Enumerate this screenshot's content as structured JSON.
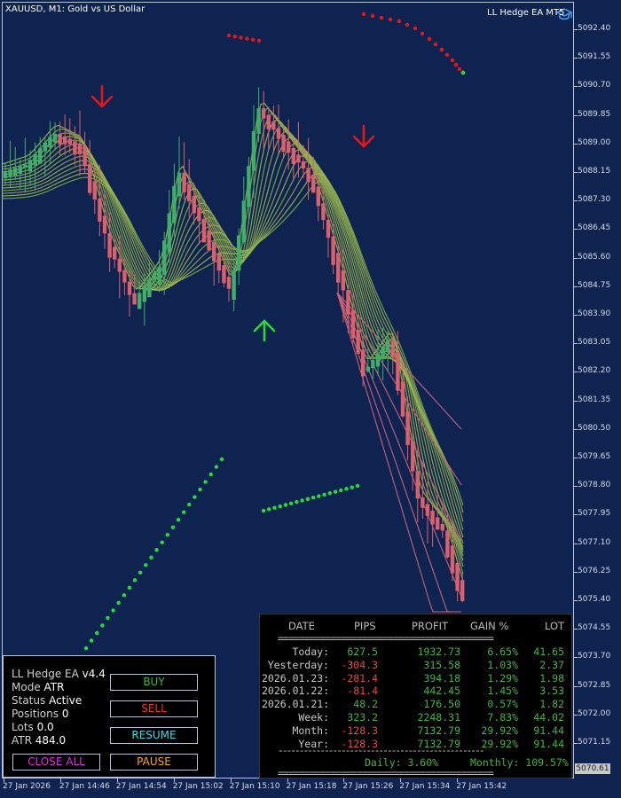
{
  "chart": {
    "title": "XAUUSD, M1:  Gold vs US Dollar",
    "ea_label": "LL Hedge EA MT5",
    "y_axis_labels": [
      "5092.40",
      "5091.55",
      "5090.70",
      "5089.85",
      "5089.00",
      "5088.15",
      "5087.30",
      "5086.45",
      "5085.60",
      "5084.75",
      "5083.90",
      "5083.05",
      "5082.20",
      "5081.35",
      "5080.50",
      "5079.65",
      "5078.80",
      "5077.95",
      "5077.10",
      "5076.25",
      "5075.40",
      "5074.55",
      "5073.70",
      "5072.85",
      "5072.00",
      "5071.15"
    ],
    "x_axis_labels": [
      "27 Jan 2026",
      "27 Jan 14:46",
      "27 Jan 14:54",
      "27 Jan 15:02",
      "27 Jan 15:10",
      "27 Jan 15:18",
      "27 Jan 15:26",
      "27 Jan 15:34",
      "27 Jan 15:42"
    ],
    "current_price": "5070.61",
    "colors": {
      "background": "#0f2350",
      "bull": "#3fae6a",
      "bear": "#d9606c",
      "ribbon": "#8fbf4a",
      "signal_up": "#22dd33",
      "signal_down": "#e21818"
    },
    "icons": [
      "arrow-down-icon",
      "arrow-down-icon",
      "arrow-up-icon",
      "graduation-cap-icon"
    ]
  },
  "ea_panel": {
    "name": "LL Hedge EA",
    "version": "v4.4",
    "mode_label": "Mode",
    "mode_value": "ATR",
    "status_label": "Status",
    "status_value": "Active",
    "positions_label": "Positions",
    "positions_value": "0",
    "lots_label": "Lots",
    "lots_value": "0.0",
    "atr_label": "ATR",
    "atr_value": "484.0",
    "buttons": {
      "buy": "BUY",
      "sell": "SELL",
      "resume": "RESUME",
      "close_all": "CLOSE ALL",
      "pause": "PAUSE"
    }
  },
  "stats": {
    "headers": [
      "DATE",
      "PIPS",
      "PROFIT",
      "GAIN %",
      "LOT"
    ],
    "separator": "=========================================",
    "rows": [
      {
        "label": "Today:",
        "pips": "627.5",
        "profit": "1932.73",
        "gain": "6.65%",
        "lot": "41.65"
      },
      {
        "label": "Yesterday:",
        "pips": "-304.3",
        "profit": "315.58",
        "gain": "1.03%",
        "lot": "2.37"
      },
      {
        "label": "2026.01.23:",
        "pips": "-281.4",
        "profit": "394.18",
        "gain": "1.29%",
        "lot": "1.98"
      },
      {
        "label": "2026.01.22:",
        "pips": "-81.4",
        "profit": "442.45",
        "gain": "1.45%",
        "lot": "3.53"
      },
      {
        "label": "2026.01.21:",
        "pips": "48.2",
        "profit": "176.50",
        "gain": "0.57%",
        "lot": "1.82"
      },
      {
        "label": "Week:",
        "pips": "323.2",
        "profit": "2248.31",
        "gain": "7.83%",
        "lot": "44.02"
      },
      {
        "label": "Month:",
        "pips": "-128.3",
        "profit": "7132.79",
        "gain": "29.92%",
        "lot": "91.44"
      },
      {
        "label": "Year:",
        "pips": "-128.3",
        "profit": "7132.79",
        "gain": "29.92%",
        "lot": "91.44"
      }
    ],
    "dash_line": "-------------------------------------------------",
    "daily": "Daily: 3.60%",
    "monthly": "Monthly: 109.57%"
  }
}
